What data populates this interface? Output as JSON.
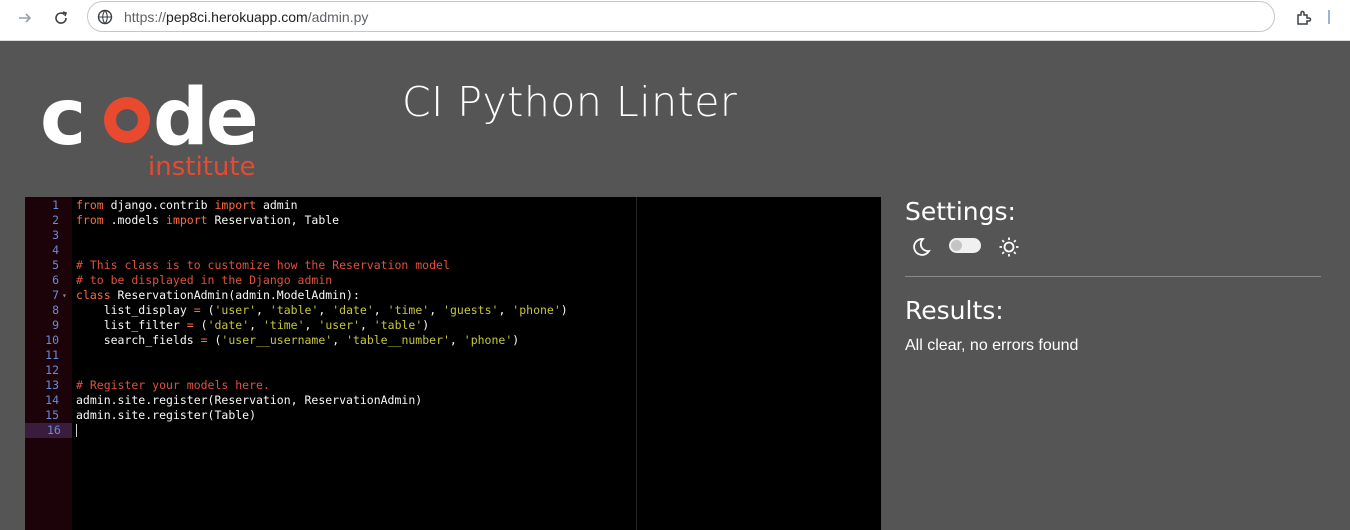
{
  "browser": {
    "url_scheme": "https://",
    "url_host": "pep8ci.herokuapp.com",
    "url_path": "/admin.py",
    "icons": {
      "forward": "arrow-right-icon",
      "reload": "reload-icon",
      "site": "site-info-icon",
      "extensions": "puzzle-extension-icon"
    }
  },
  "header": {
    "logo_word": "code",
    "logo_sub": "institute",
    "title": "CI Python Linter",
    "colors": {
      "logo_accent": "#e8492f",
      "logo_main": "#ffffff"
    }
  },
  "editor": {
    "active_line": 16,
    "lines": [
      [
        [
          "kw",
          "from"
        ],
        [
          "t",
          " django.contrib "
        ],
        [
          "kw",
          "import"
        ],
        [
          "t",
          " admin"
        ]
      ],
      [
        [
          "kw",
          "from"
        ],
        [
          "t",
          " .models "
        ],
        [
          "kw",
          "import"
        ],
        [
          "t",
          " Reservation, Table"
        ]
      ],
      [],
      [],
      [
        [
          "cm",
          "# This class is to customize how the Reservation model"
        ]
      ],
      [
        [
          "cm",
          "# to be displayed in the Django admin"
        ]
      ],
      [
        [
          "kw",
          "class"
        ],
        [
          "t",
          " ReservationAdmin(admin.ModelAdmin):"
        ]
      ],
      [
        [
          "t",
          "    list_display "
        ],
        [
          "op",
          "="
        ],
        [
          "t",
          " ("
        ],
        [
          "str",
          "'user'"
        ],
        [
          "t",
          ", "
        ],
        [
          "str",
          "'table'"
        ],
        [
          "t",
          ", "
        ],
        [
          "str",
          "'date'"
        ],
        [
          "t",
          ", "
        ],
        [
          "str",
          "'time'"
        ],
        [
          "t",
          ", "
        ],
        [
          "str",
          "'guests'"
        ],
        [
          "t",
          ", "
        ],
        [
          "str",
          "'phone'"
        ],
        [
          "t",
          ")"
        ]
      ],
      [
        [
          "t",
          "    list_filter "
        ],
        [
          "op",
          "="
        ],
        [
          "t",
          " ("
        ],
        [
          "str",
          "'date'"
        ],
        [
          "t",
          ", "
        ],
        [
          "str",
          "'time'"
        ],
        [
          "t",
          ", "
        ],
        [
          "str",
          "'user'"
        ],
        [
          "t",
          ", "
        ],
        [
          "str",
          "'table'"
        ],
        [
          "t",
          ")"
        ]
      ],
      [
        [
          "t",
          "    search_fields "
        ],
        [
          "op",
          "="
        ],
        [
          "t",
          " ("
        ],
        [
          "str",
          "'user__username'"
        ],
        [
          "t",
          ", "
        ],
        [
          "str",
          "'table__number'"
        ],
        [
          "t",
          ", "
        ],
        [
          "str",
          "'phone'"
        ],
        [
          "t",
          ")"
        ]
      ],
      [],
      [],
      [
        [
          "cm",
          "# Register your models here."
        ]
      ],
      [
        [
          "t",
          "admin.site.register(Reservation, ReservationAdmin)"
        ]
      ],
      [
        [
          "t",
          "admin.site.register(Table)"
        ]
      ],
      []
    ]
  },
  "sidebar": {
    "settings_heading": "Settings:",
    "dark_icon": "moon-icon",
    "light_icon": "sun-icon",
    "theme_toggle_on": false,
    "results_heading": "Results:",
    "results_text": "All clear, no errors found"
  }
}
